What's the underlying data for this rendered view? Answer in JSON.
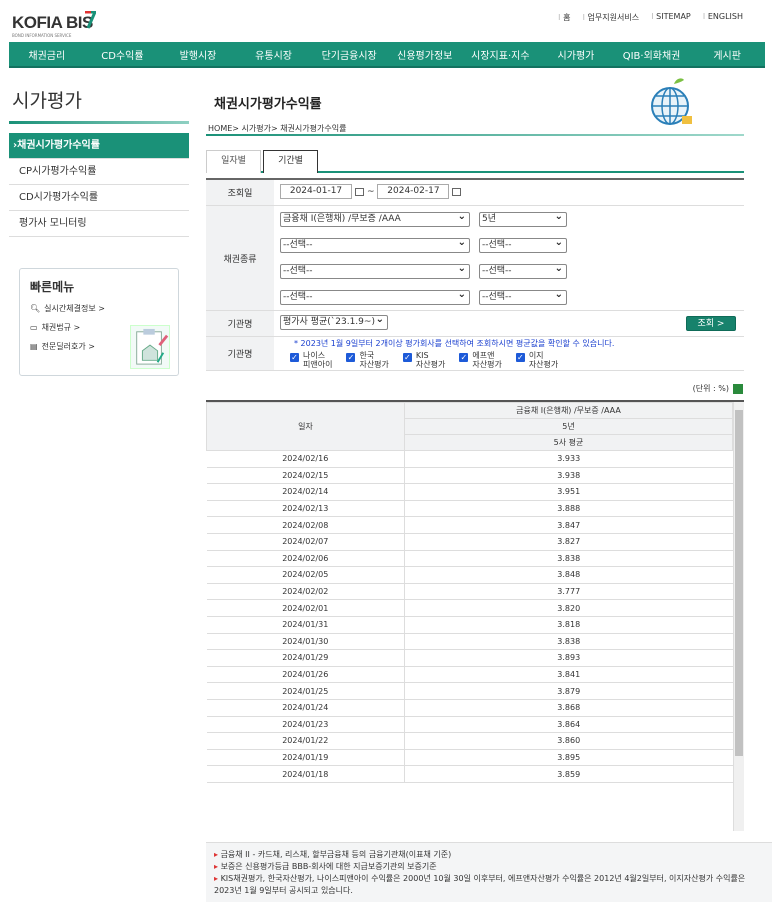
{
  "header": {
    "logo_text": "KOFIA BIS",
    "logo_sub": "BOND INFORMATION SERVICE",
    "util_links": [
      "홈",
      "업무지원서비스",
      "SITEMAP",
      "ENGLISH"
    ]
  },
  "gnb": [
    "채권금리",
    "CD수익률",
    "발행시장",
    "유통시장",
    "단기금융시장",
    "신용평가정보",
    "시장지표·지수",
    "시가평가",
    "QIB·외화채권",
    "게시판"
  ],
  "sidebar": {
    "title": "시가평가",
    "items": [
      {
        "label": "채권시가평가수익률",
        "active": true
      },
      {
        "label": "CP시가평가수익률"
      },
      {
        "label": "CD시가평가수익률"
      },
      {
        "label": "평가사 모니터링"
      }
    ],
    "quick": {
      "title": "빠른메뉴",
      "items": [
        "실시간체결정보 >",
        "채권법규 >",
        "전문딜러호가 >"
      ]
    }
  },
  "page": {
    "title": "채권시가평가수익률",
    "breadcrumb": "HOME> 시가평가> 채권시가평가수익률",
    "tabs": [
      "일자별",
      "기간별"
    ]
  },
  "form": {
    "date_label": "조회일",
    "date_from": "2024-01-17",
    "date_sep": "~",
    "date_to": "2024-02-17",
    "bond_label": "채권종류",
    "bond_rows": [
      {
        "type": "금융채 I(은행채) /무보증 /AAA",
        "term": "5년"
      },
      {
        "type": "--선택--",
        "term": "--선택--"
      },
      {
        "type": "--선택--",
        "term": "--선택--"
      },
      {
        "type": "--선택--",
        "term": "--선택--"
      }
    ],
    "agency_label": "기관명",
    "agency_value": "평가사 평균(`23.1.9~)",
    "search_button": "조회 >",
    "agency_label2": "기관명",
    "note": "* 2023년 1월 9일부터 2개이상 평가회사를 선택하여 조회하시면 평균값을 확인할 수 있습니다.",
    "agencies": [
      {
        "l1": "나이스",
        "l2": "피앤아이"
      },
      {
        "l1": "한국",
        "l2": "자산평가"
      },
      {
        "l1": "KIS",
        "l2": "자산평가"
      },
      {
        "l1": "에프앤",
        "l2": "자산평가"
      },
      {
        "l1": "이지",
        "l2": "자산평가"
      }
    ]
  },
  "unit": "(단위 : %)",
  "table": {
    "col_date": "일자",
    "col_bond": "금융채 I(은행채) /무보증 /AAA",
    "col_term": "5년",
    "col_avg": "5사 평균",
    "rows": [
      [
        "2024/02/16",
        "3.933"
      ],
      [
        "2024/02/15",
        "3.938"
      ],
      [
        "2024/02/14",
        "3.951"
      ],
      [
        "2024/02/13",
        "3.888"
      ],
      [
        "2024/02/08",
        "3.847"
      ],
      [
        "2024/02/07",
        "3.827"
      ],
      [
        "2024/02/06",
        "3.838"
      ],
      [
        "2024/02/05",
        "3.848"
      ],
      [
        "2024/02/02",
        "3.777"
      ],
      [
        "2024/02/01",
        "3.820"
      ],
      [
        "2024/01/31",
        "3.818"
      ],
      [
        "2024/01/30",
        "3.838"
      ],
      [
        "2024/01/29",
        "3.893"
      ],
      [
        "2024/01/26",
        "3.841"
      ],
      [
        "2024/01/25",
        "3.879"
      ],
      [
        "2024/01/24",
        "3.868"
      ],
      [
        "2024/01/23",
        "3.864"
      ],
      [
        "2024/01/22",
        "3.860"
      ],
      [
        "2024/01/19",
        "3.895"
      ],
      [
        "2024/01/18",
        "3.859"
      ]
    ]
  },
  "footnotes": [
    "금융채 II - 카드채, 리스채, 할부금융채 등의 금융기관채(이표채 기준)",
    "보증은 신용평가등급 BBB-회사에 대한 지급보증기관의 보증기준",
    "KIS채권평가, 한국자산평가, 나이스피앤아이 수익률은 2000년 10월 30일 이후부터, 에프앤자산평가 수익률은 2012년 4월2일부터, 이지자산평가 수익률은 2023년 1월 9일부터 공시되고 있습니다."
  ],
  "colors": {
    "brand": "#1a9178",
    "link_blue": "#1a3fcf",
    "checkbox": "#1d5ad8"
  }
}
